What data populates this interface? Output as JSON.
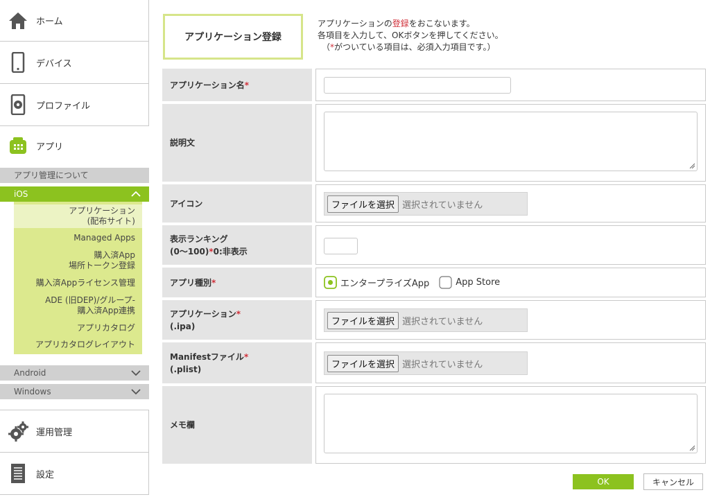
{
  "sidebar": {
    "home": "ホーム",
    "device": "デバイス",
    "profile": "プロファイル",
    "app": "アプリ",
    "about": "アプリ管理について",
    "ios": "iOS",
    "ios_items": {
      "app_distribution_1": "アプリケーション",
      "app_distribution_2": "(配布サイト)",
      "managed_apps": "Managed Apps",
      "purchased_1": "購入済App",
      "purchased_2": "場所トークン登録",
      "license": "購入済Appライセンス管理",
      "ade_1": "ADE (旧DEP)/グループ-",
      "ade_2": "購入済App連携",
      "catalog": "アプリカタログ",
      "catalog_layout": "アプリカタログレイアウト"
    },
    "android": "Android",
    "windows": "Windows",
    "operation": "運用管理",
    "settings": "設定"
  },
  "page": {
    "title": "アプリケーション登録",
    "intro_1a": "アプリケーションの",
    "intro_1b": "登録",
    "intro_1c": "をおこないます。",
    "intro_2": "各項目を入力して、OKボタンを押してください。",
    "intro_3a": "（",
    "intro_3b": "*",
    "intro_3c": "がついている項目は、必須入力項目です。）"
  },
  "form": {
    "app_name": "アプリケーション名",
    "required_mark": "*",
    "description": "説明文",
    "icon": "アイコン",
    "ranking_1": "表示ランキング",
    "ranking_2a": "(0〜100)",
    "ranking_2c": "0:非表示",
    "app_type": "アプリ種別",
    "type_enterprise": "エンタープライズApp",
    "type_appstore": "App Store",
    "application": "アプリケーション",
    "ipa": "(.ipa)",
    "manifest": "Manifestファイル",
    "plist": "(.plist)",
    "memo": "メモ欄",
    "file_button": "ファイルを選択",
    "no_file": "選択されていません"
  },
  "buttons": {
    "ok": "OK",
    "cancel": "キャンセル"
  },
  "colors": {
    "accent": "#8cc21f",
    "accent_light": "#dce98e",
    "required": "#d0303a"
  }
}
